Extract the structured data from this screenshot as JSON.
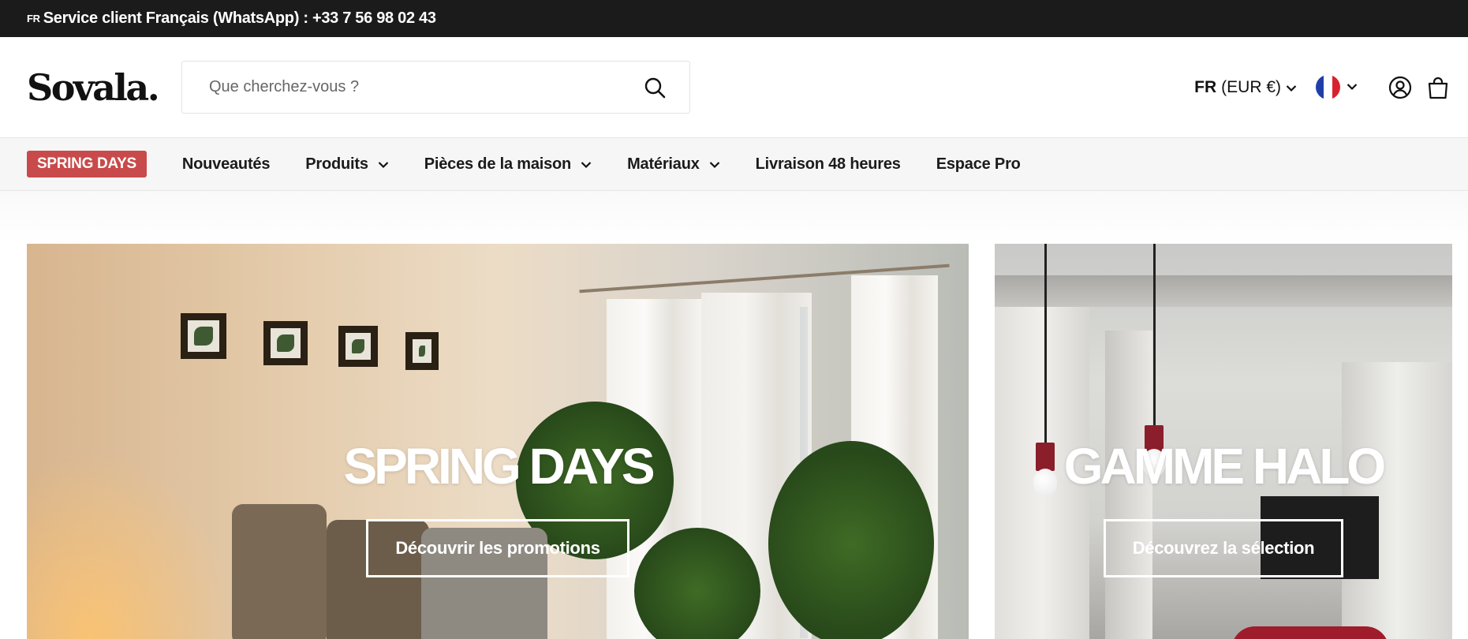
{
  "topbar": {
    "lang_code": "FR",
    "text": "Service client Français (WhatsApp) : +33 7 56 98 02 43"
  },
  "header": {
    "logo": "Sovala.",
    "search_placeholder": "Que cherchez-vous ?",
    "locale_code": "FR",
    "locale_currency": "(EUR €)"
  },
  "nav": {
    "badge": "SPRING DAYS",
    "items": [
      {
        "label": "Nouveautés"
      },
      {
        "label": "Produits"
      },
      {
        "label": "Pièces de la maison"
      },
      {
        "label": "Matériaux"
      },
      {
        "label": "Livraison 48 heures"
      },
      {
        "label": "Espace Pro"
      }
    ]
  },
  "heroes": [
    {
      "title": "SPRING DAYS",
      "button": "Découvrir les promotions"
    },
    {
      "title": "GAMME HALO",
      "button": "Découvrez la sélection"
    }
  ],
  "colors": {
    "topbar_bg": "#1b1b1b",
    "badge_bg": "#c94a4a",
    "nav_bg": "#f6f6f6",
    "flag_blue": "#1f3fa8",
    "flag_red": "#d8212f"
  }
}
